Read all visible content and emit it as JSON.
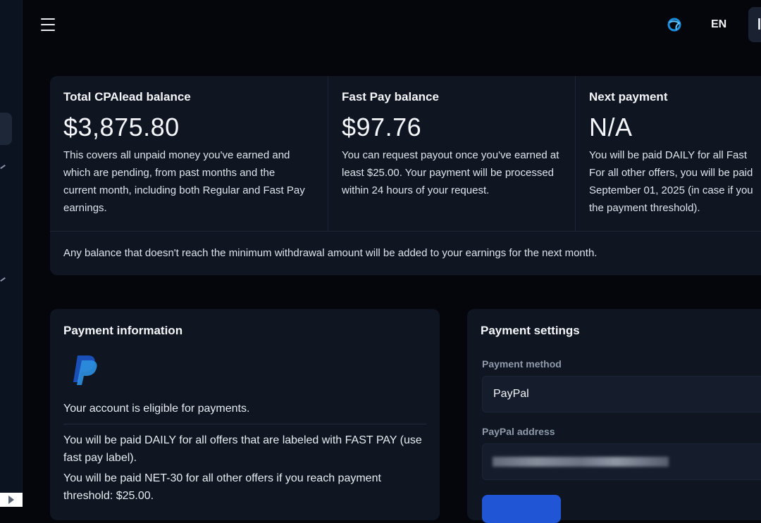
{
  "header": {
    "language": "EN",
    "icons": {
      "menu": "hamburger-icon",
      "globe": "globe-icon"
    },
    "accent_color": "#1a8fe0"
  },
  "balances": {
    "total": {
      "title": "Total CPAlead balance",
      "amount": "$3,875.80",
      "description": "This covers all unpaid money you've earned and which are pending, from past months and the current month, including both Regular and Fast Pay earnings."
    },
    "fast_pay": {
      "title": "Fast Pay balance",
      "amount": "$97.76",
      "description": "You can request payout once you've earned at least $25.00. Your payment will be processed within 24 hours of your request."
    },
    "next_payment": {
      "title": "Next payment",
      "amount": "N/A",
      "description": "You will be paid DAILY for all Fast For all other offers, you will be paid September 01, 2025 (in case if you the payment threshold)."
    },
    "note": "Any balance that doesn't reach the minimum withdrawal amount will be added to your earnings for the next month."
  },
  "payment_information": {
    "title": "Payment information",
    "logo": "paypal-logo",
    "eligible_text": "Your account is eligible for payments.",
    "daily_text": "You will be paid DAILY for all offers that are labeled with FAST PAY (use fast pay label).",
    "net30_text": "You will be paid NET-30 for all other offers if you reach payment threshold: $25.00."
  },
  "payment_settings": {
    "title": "Payment settings",
    "method_label": "Payment method",
    "method_value": "PayPal",
    "address_label": "PayPal address",
    "button_color": "#2056d6"
  }
}
